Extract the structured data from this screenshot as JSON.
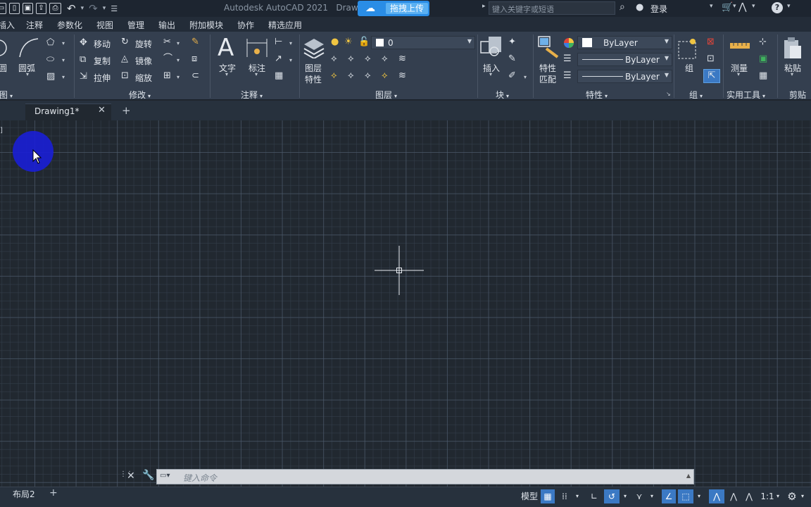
{
  "titlebar": {
    "app_title": "Autodesk AutoCAD 2021",
    "doc_title_partial": "Draw",
    "upload_label": "拖拽上传",
    "search_placeholder": "键入关键字或短语",
    "login_label": "登录",
    "qat_icons": [
      "new-icon",
      "open-icon",
      "save-icon",
      "save-as-icon",
      "plot-icon",
      "undo-icon",
      "redo-icon",
      "customize-icon"
    ]
  },
  "menu": {
    "tabs": [
      "插入",
      "注释",
      "参数化",
      "视图",
      "管理",
      "输出",
      "附加模块",
      "协作",
      "精选应用"
    ]
  },
  "ribbon": {
    "draw": {
      "arc_label": "圆弧",
      "title": "图"
    },
    "modify": {
      "title": "修改",
      "items": [
        "移动",
        "旋转",
        "复制",
        "镜像",
        "拉伸",
        "缩放"
      ]
    },
    "annotation": {
      "title": "注释",
      "text_label": "文字",
      "dimension_label": "标注"
    },
    "layers": {
      "title": "图层",
      "props_label_1": "图层",
      "props_label_2": "特性",
      "current_layer": "0"
    },
    "block": {
      "title": "块",
      "insert_label": "插入"
    },
    "properties": {
      "title": "特性",
      "match_label_1": "特性",
      "match_label_2": "匹配",
      "color": "ByLayer",
      "linetype": "ByLayer",
      "lineweight": "ByLayer"
    },
    "group": {
      "title": "组",
      "group_label": "组"
    },
    "utilities": {
      "title": "实用工具",
      "measure_label": "测量"
    },
    "clipboard": {
      "title": "剪贴板",
      "paste_label": "粘贴"
    }
  },
  "filetabs": {
    "current": "Drawing1*",
    "close": "✕",
    "add": "+"
  },
  "command": {
    "placeholder": "键入命令"
  },
  "status": {
    "layout_tab": "布局2",
    "model_label": "模型",
    "scale_label": "1:1"
  }
}
